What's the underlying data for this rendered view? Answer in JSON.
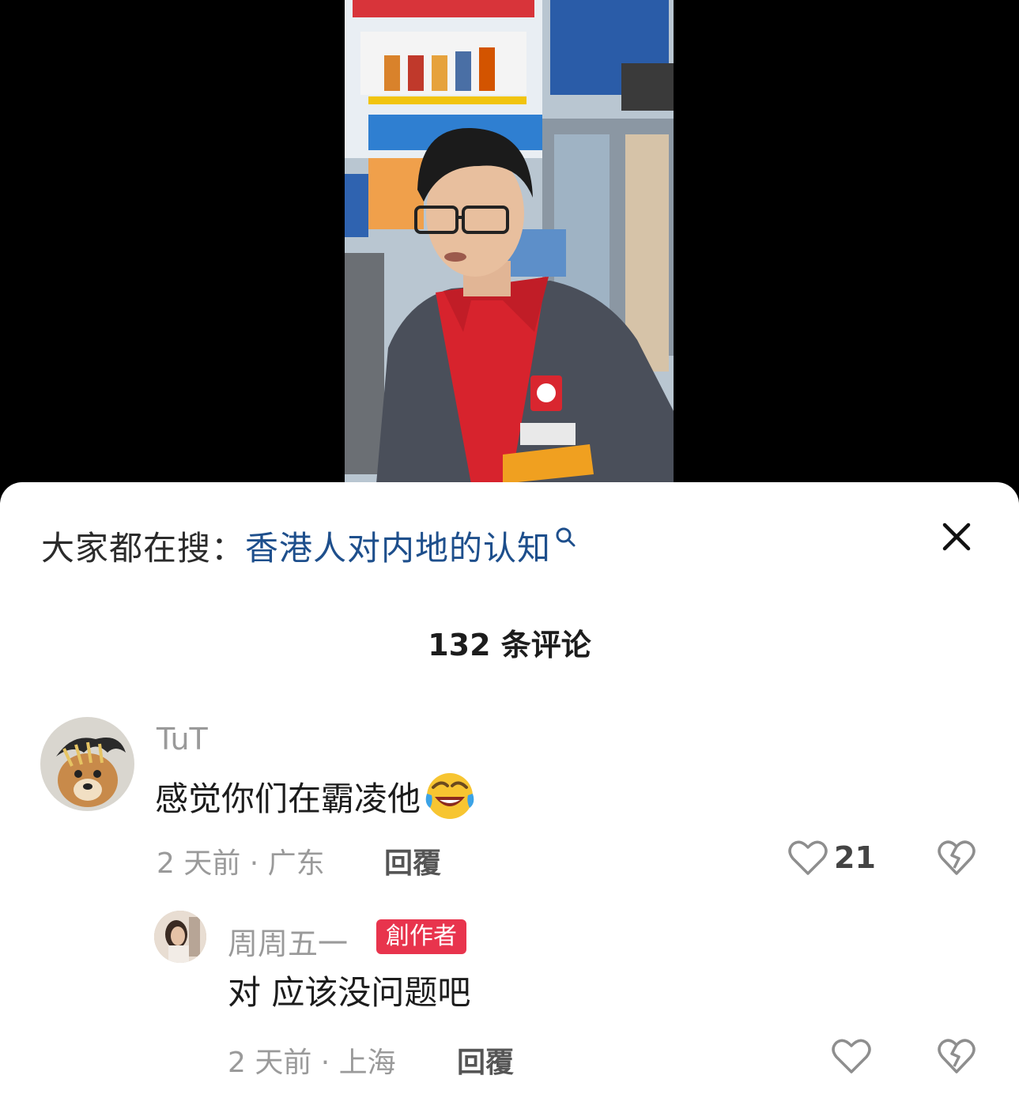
{
  "search": {
    "prefix": "大家都在搜：",
    "term": "香港人对内地的认知",
    "icon": "search-icon"
  },
  "close_icon": "close-icon",
  "comments_header": {
    "count_label": "132 条评论"
  },
  "comments": [
    {
      "username": "TuT",
      "text": "感觉你们在霸凌他",
      "emoji": "rolling-laughing-emoji",
      "time_location": "2 天前 · 广东",
      "reply_label": "回覆",
      "like_count": "21"
    }
  ],
  "replies": [
    {
      "username": "周周五一",
      "badge": "創作者",
      "text": "对 应该没问题吧",
      "time_location": "2 天前 · 上海",
      "reply_label": "回覆"
    }
  ],
  "colors": {
    "search_term": "#1e4f8c",
    "creator_badge": "#e8344d"
  }
}
